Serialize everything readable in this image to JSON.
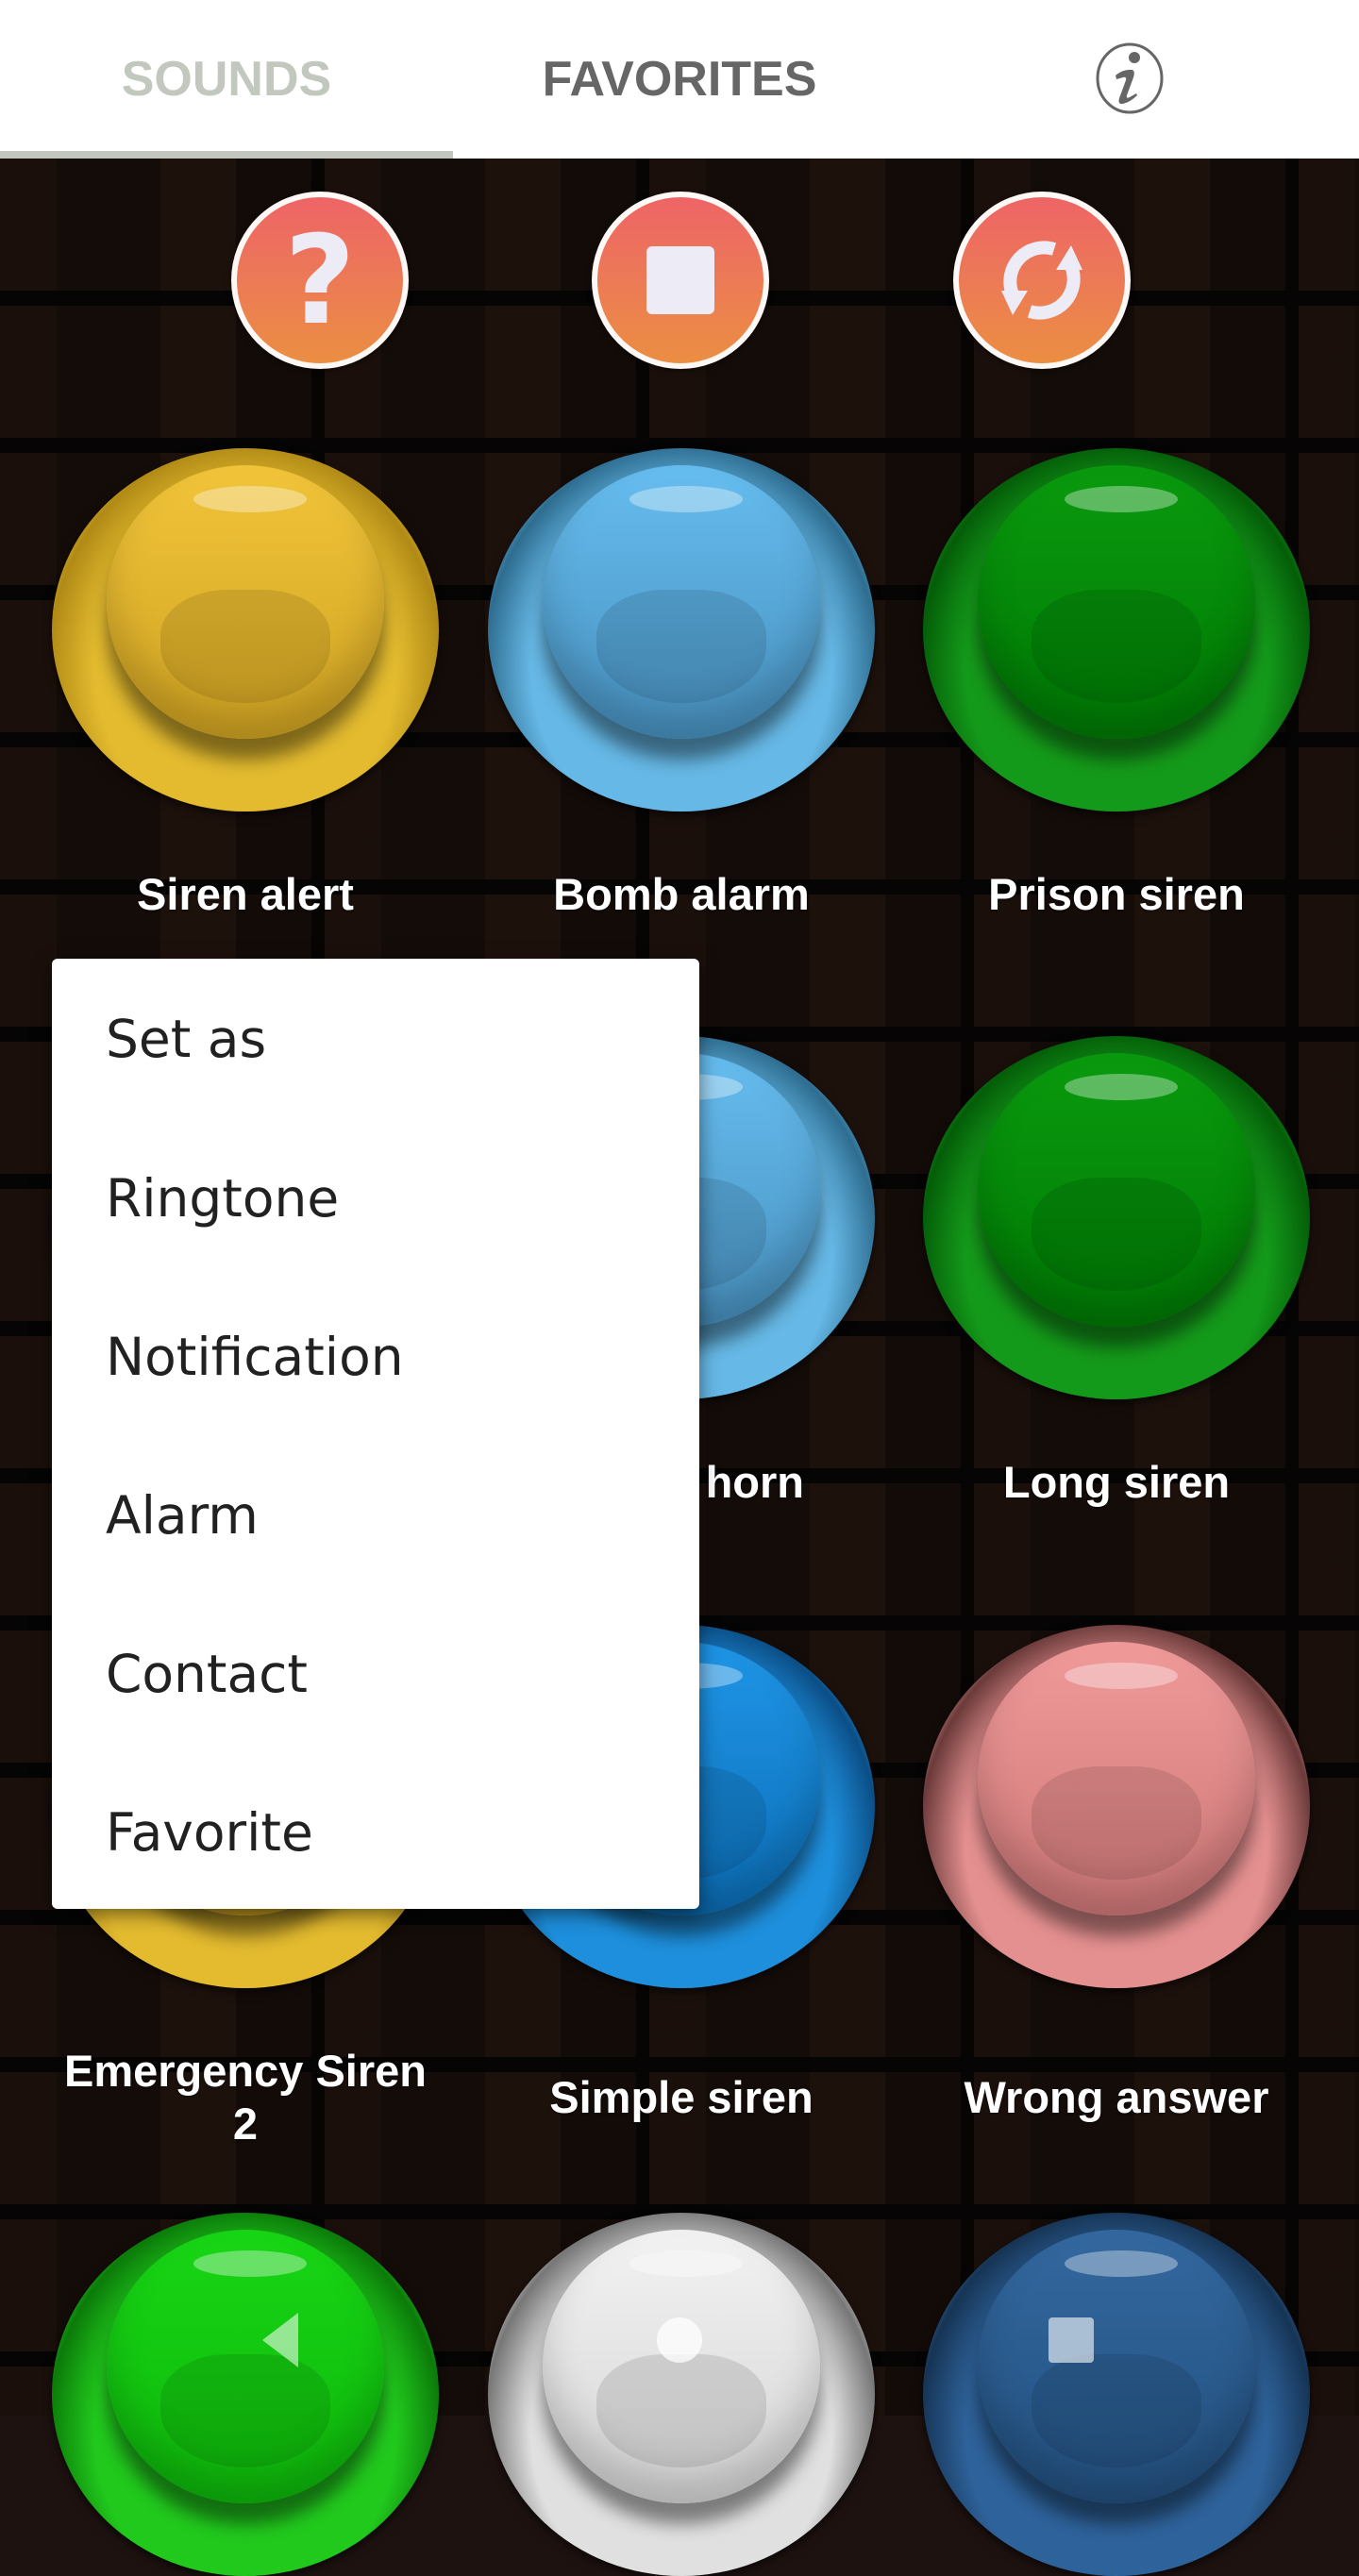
{
  "tabs": [
    {
      "label": "SOUNDS",
      "selected": true
    },
    {
      "label": "FAVORITES",
      "selected": false
    }
  ],
  "header": {
    "info_icon": "info-icon"
  },
  "controls": [
    {
      "name": "help",
      "icon": "question-mark-icon"
    },
    {
      "name": "stop",
      "icon": "stop-icon"
    },
    {
      "name": "replay",
      "icon": "refresh-icon"
    }
  ],
  "sounds": [
    {
      "label": "Siren alert",
      "color": "#e4bb2f"
    },
    {
      "label": "Bomb alarm",
      "color": "#66b8e6"
    },
    {
      "label": "Prison siren",
      "color": "#149a1a"
    },
    {
      "label": "",
      "color": "#e4bb2f",
      "partial_label": ""
    },
    {
      "label": "horn",
      "color": "#66b8e6"
    },
    {
      "label": "Long siren",
      "color": "#149a1a"
    },
    {
      "label": "Emergency Siren 2",
      "color": "#e4bb2f"
    },
    {
      "label": "Simple siren",
      "color": "#1e8fdc"
    },
    {
      "label": "Wrong answer",
      "color": "#e59090"
    },
    {
      "label": "",
      "color": "#21c91d"
    },
    {
      "label": "",
      "color": "#e0e0e0"
    },
    {
      "label": "",
      "color": "#2e629a"
    }
  ],
  "popup_menu": {
    "title": "Set as",
    "items": [
      "Ringtone",
      "Notification",
      "Alarm",
      "Contact",
      "Favorite"
    ]
  },
  "nav_bar": {
    "back": "back-icon",
    "home": "home-icon",
    "recents": "recents-icon"
  },
  "colors": {
    "tab_selected": "#c2c8be",
    "tab_unselected": "#666666",
    "control_gradient_top": "#ee6466",
    "control_gradient_bottom": "#eb8e42",
    "menu_text": "#212121"
  }
}
